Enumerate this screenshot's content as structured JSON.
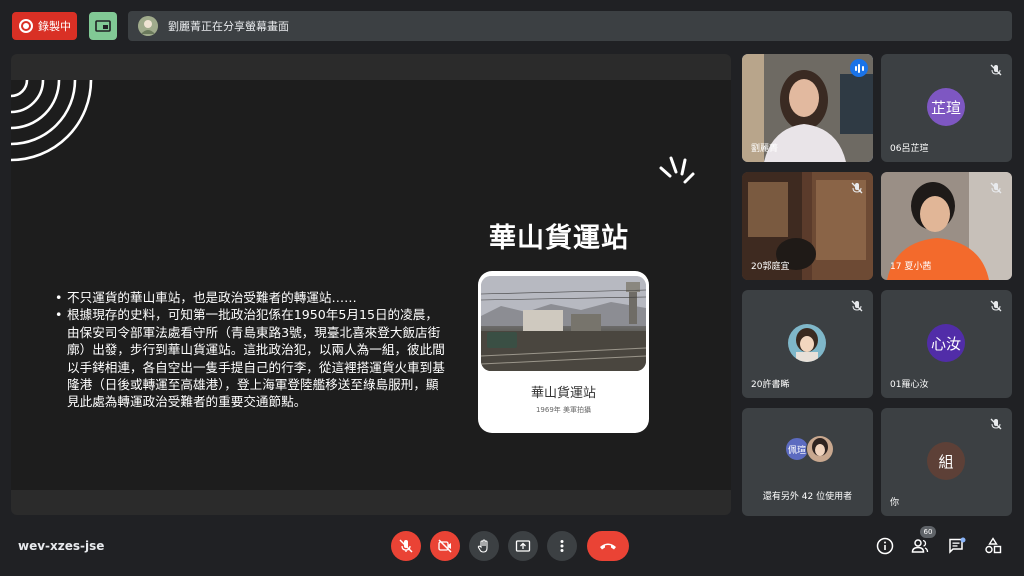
{
  "topbar": {
    "recording_label": "錄製中",
    "share_text": "劉麗菁正在分享螢幕畫面"
  },
  "slide": {
    "title": "華山貨運站",
    "bullets": [
      "不只運貨的華山車站，也是政治受難者的轉運站……",
      "根據現存的史料，可知第一批政治犯係在1950年5月15日的凌晨，由保安司令部軍法處看守所（青島東路3號，現臺北喜來登大飯店街廓）出發，步行到華山貨運站。這批政治犯，以兩人為一組，彼此間以手銬相連，各自空出一隻手提自己的行李，從這裡搭運貨火車到基隆港（日後或轉運至高雄港），登上海軍登陸艦移送至綠島服刑，顯見此處為轉運政治受難者的重要交通節點。"
    ],
    "photo_caption": "華山貨運站",
    "photo_subcaption": "1969年 美軍拍攝"
  },
  "participants": [
    {
      "name": "劉麗菁",
      "type": "video"
    },
    {
      "name": "06呂芷瑄",
      "avatar_text": "芷瑄",
      "color": "#7e57c2"
    },
    {
      "name": "20郭庭宜",
      "type": "video"
    },
    {
      "name": "17 夏小茜",
      "type": "video"
    },
    {
      "name": "20許書睎",
      "type": "photo"
    },
    {
      "name": "01羅心汝",
      "avatar_text": "心汝",
      "color": "#512da8"
    },
    {
      "name": "還有另外 42 位使用者",
      "avatar_text": "佩瑄",
      "color": "#5c6bc0"
    },
    {
      "name": "你",
      "avatar_text": "組",
      "color": "#5d4037"
    }
  ],
  "bottom": {
    "meeting_code": "wev-xzes-jse",
    "people_count": "60"
  },
  "colors": {
    "end_call": "#ea4335",
    "accent": "#8ab4f8",
    "recording": "#d93025"
  },
  "icons": [
    "mic-off-icon",
    "camera-off-icon",
    "raise-hand-icon",
    "present-icon",
    "more-icon",
    "end-call-icon",
    "info-icon",
    "people-icon",
    "chat-icon",
    "activities-icon"
  ]
}
